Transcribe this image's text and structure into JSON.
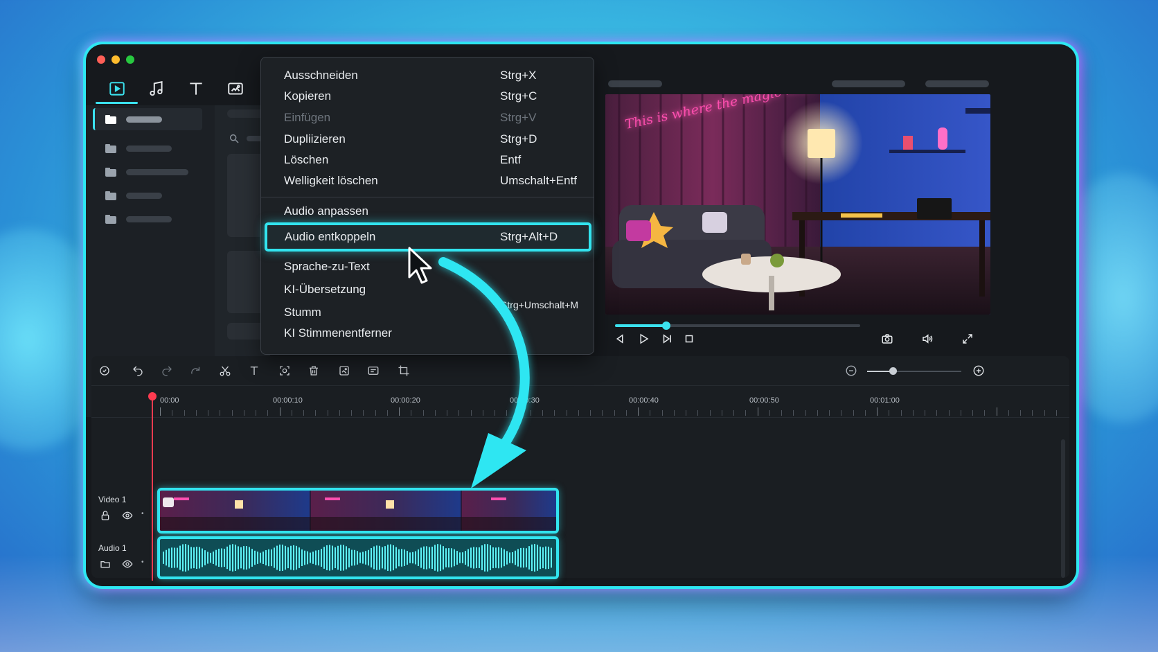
{
  "context_menu": {
    "items": [
      {
        "label": "Ausschneiden",
        "shortcut": "Strg+X"
      },
      {
        "label": "Kopieren",
        "shortcut": "Strg+C"
      },
      {
        "label": "Einfügen",
        "shortcut": "Strg+V"
      },
      {
        "label": "Dupliizieren",
        "shortcut": "Strg+D"
      },
      {
        "label": "Löschen",
        "shortcut": "Entf"
      },
      {
        "label": "Welligkeit löschen",
        "shortcut": "Umschalt+Entf"
      },
      {
        "label": "Audio anpassen",
        "shortcut": ""
      },
      {
        "label": "Audio entkoppeln",
        "shortcut": "Strg+Alt+D"
      },
      {
        "label": "Sprache-zu-Text",
        "shortcut": ""
      },
      {
        "label": "KI-Übersetzung",
        "shortcut": ""
      },
      {
        "label": "Stumm",
        "shortcut": "Strg+Umschalt+M"
      },
      {
        "label": "KI Stimmenentferner",
        "shortcut": ""
      }
    ]
  },
  "preview": {
    "neon_sign": "This is where the magic happens",
    "playback_progress": 0.21
  },
  "timeline": {
    "ruler_labels": [
      "00:00",
      "00:00:10",
      "00:00:20",
      "00:00:30",
      "00:00:40",
      "00:00:50",
      "00:01:00"
    ],
    "tracks": [
      {
        "name": "Video 1"
      },
      {
        "name": "Audio 1"
      }
    ],
    "zoom_level": 0.27
  },
  "colors": {
    "accent": "#32e4ef",
    "playhead": "#ff3b50",
    "window_bg": "#16191d"
  }
}
